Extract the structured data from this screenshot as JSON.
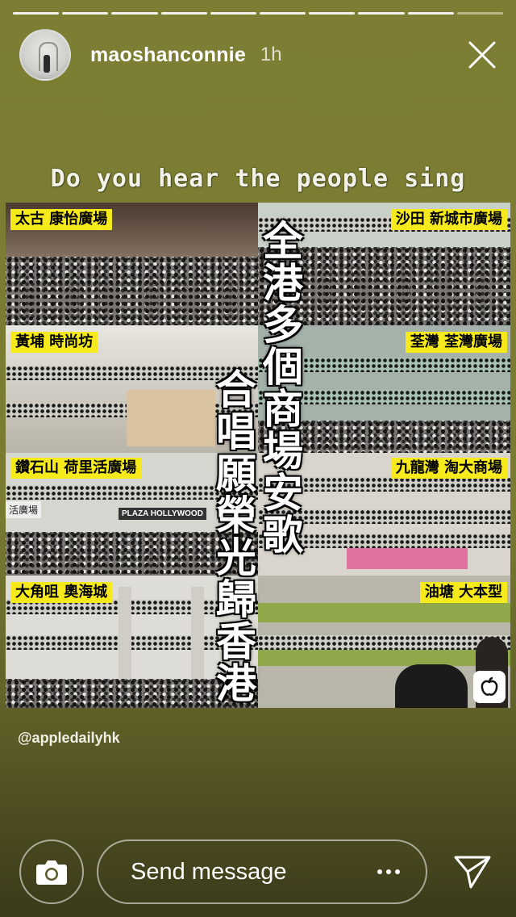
{
  "story": {
    "username": "maoshanconnie",
    "time": "1h",
    "progress_segments": 10,
    "progress_completed": 9,
    "caption": "Do you hear the people sing",
    "source_credit": "@appledailyhk"
  },
  "collage": {
    "headline_right": "全港多個商場安歌",
    "headline_left": "合唱願榮光歸香港",
    "location_tags": [
      "太古 康怡廣場",
      "沙田 新城市廣場",
      "黃埔 時尚坊",
      "荃灣 荃灣廣場",
      "鑽石山 荷里活廣場",
      "九龍灣 淘大商場",
      "大角咀 奧海城",
      "油塘 大本型"
    ],
    "signage": [
      "活廣場",
      "PLAZA HOLLYWOOD"
    ]
  },
  "footer": {
    "message_placeholder": "Send message"
  },
  "colors": {
    "background": "#7d7e33",
    "tag_yellow": "#f6ea1d"
  },
  "icons": {
    "close": "close-icon",
    "camera": "camera-icon",
    "more": "more-dots-icon",
    "send": "send-paper-plane-icon"
  }
}
